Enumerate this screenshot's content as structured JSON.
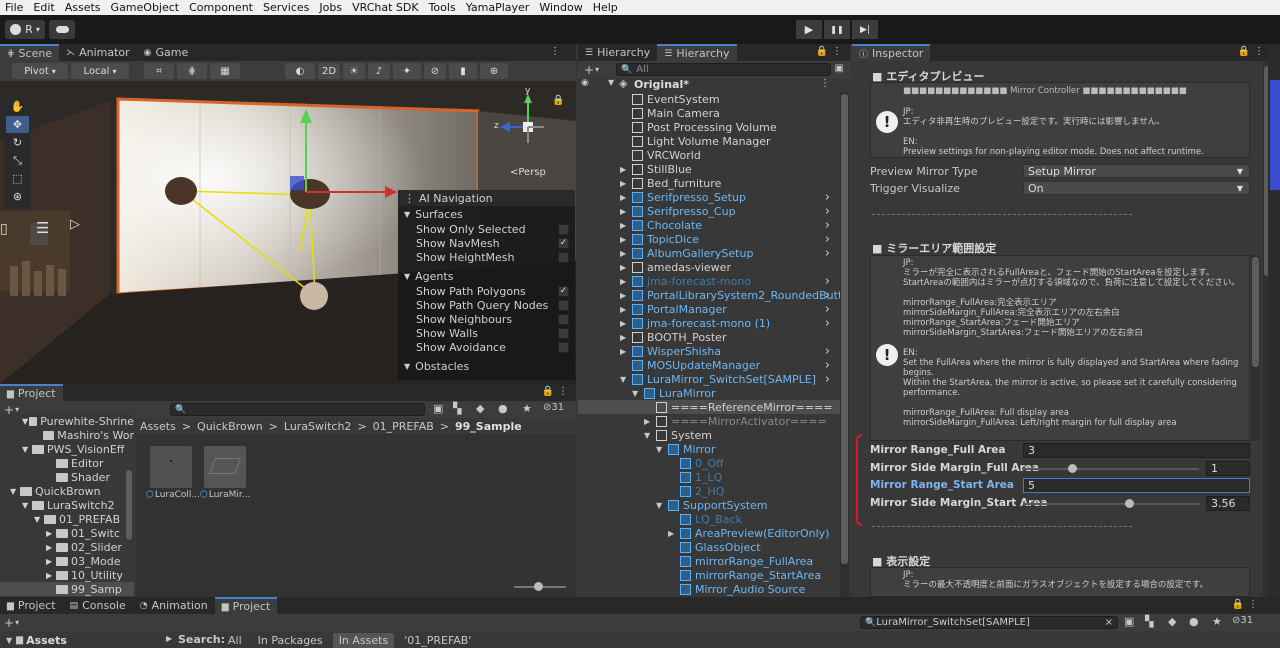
{
  "menubar": [
    "File",
    "Edit",
    "Assets",
    "GameObject",
    "Component",
    "Services",
    "Jobs",
    "VRChat SDK",
    "Tools",
    "YamaPlayer",
    "Window",
    "Help"
  ],
  "toolbar": {
    "account_label": "R",
    "cloud_icon": "cloud-icon",
    "play": "▶",
    "pause": "❚❚",
    "step": "▶|"
  },
  "scene": {
    "tabs": [
      "Scene",
      "Animator",
      "Game"
    ],
    "pivot": "Pivot",
    "local": "Local",
    "mode_2d": "2D",
    "persp": "<Persp",
    "gizmo_axes": {
      "y": "y",
      "z": "z"
    },
    "nav": {
      "title": "AI Navigation",
      "surfaces": "Surfaces",
      "surface_items": [
        {
          "label": "Show Only Selected",
          "checked": ""
        },
        {
          "label": "Show NavMesh",
          "checked": "✓"
        },
        {
          "label": "Show HeightMesh",
          "checked": ""
        }
      ],
      "agents": "Agents",
      "agent_items": [
        {
          "label": "Show Path Polygons",
          "checked": "✓"
        },
        {
          "label": "Show Path Query Nodes",
          "checked": ""
        },
        {
          "label": "Show Neighbours",
          "checked": ""
        },
        {
          "label": "Show Walls",
          "checked": ""
        },
        {
          "label": "Show Avoidance",
          "checked": ""
        }
      ],
      "obstacles": "Obstacles"
    }
  },
  "project": {
    "tab": "Project",
    "count": "31",
    "tree": [
      {
        "label": "Purewhite-Shrine",
        "indent": 2,
        "arrow": "▼"
      },
      {
        "label": "Mashiro's Wor",
        "indent": 3,
        "arrow": ""
      },
      {
        "label": "PWS_VisionEff",
        "indent": 2,
        "arrow": "▼"
      },
      {
        "label": "Editor",
        "indent": 4,
        "arrow": ""
      },
      {
        "label": "Shader",
        "indent": 4,
        "arrow": ""
      },
      {
        "label": "QuickBrown",
        "indent": 1,
        "arrow": "▼"
      },
      {
        "label": "LuraSwitch2",
        "indent": 2,
        "arrow": "▼"
      },
      {
        "label": "01_PREFAB",
        "indent": 3,
        "arrow": "▼"
      },
      {
        "label": "01_Switc",
        "indent": 4,
        "arrow": "▶"
      },
      {
        "label": "02_Slider",
        "indent": 4,
        "arrow": "▶"
      },
      {
        "label": "03_Mode",
        "indent": 4,
        "arrow": "▶"
      },
      {
        "label": "10_Utility",
        "indent": 4,
        "arrow": "▶"
      },
      {
        "label": "99_Samp",
        "indent": 4,
        "arrow": ""
      }
    ],
    "breadcrumb": [
      "Assets",
      "QuickBrown",
      "LuraSwitch2",
      "01_PREFAB",
      "99_Sample"
    ],
    "assets": [
      "LuraColl...",
      "LuraMir..."
    ]
  },
  "hierarchy": {
    "tabs": [
      "Hierarchy",
      "Hierarchy"
    ],
    "search_placeholder": "All",
    "scene": "Original*",
    "items": [
      {
        "label": "EventSystem",
        "indent": 1,
        "blue": false,
        "arrow": "",
        "more": false,
        "dim": false
      },
      {
        "label": "Main Camera",
        "indent": 1,
        "blue": false,
        "arrow": "",
        "more": false,
        "dim": false
      },
      {
        "label": "Post Processing Volume",
        "indent": 1,
        "blue": false,
        "arrow": "",
        "more": false,
        "dim": false
      },
      {
        "label": "Light Volume Manager",
        "indent": 1,
        "blue": false,
        "arrow": "",
        "more": false,
        "dim": false
      },
      {
        "label": "VRCWorld",
        "indent": 1,
        "blue": false,
        "arrow": "",
        "more": false,
        "dim": false
      },
      {
        "label": "StillBlue",
        "indent": 1,
        "blue": false,
        "arrow": "▶",
        "more": false,
        "dim": false
      },
      {
        "label": "Bed_furniture",
        "indent": 1,
        "blue": false,
        "arrow": "▶",
        "more": false,
        "dim": false
      },
      {
        "label": "Serifpresso_Setup",
        "indent": 1,
        "blue": true,
        "arrow": "▶",
        "more": true,
        "dim": false
      },
      {
        "label": "Serifpresso_Cup",
        "indent": 1,
        "blue": true,
        "arrow": "▶",
        "more": true,
        "dim": false
      },
      {
        "label": "Chocolate",
        "indent": 1,
        "blue": true,
        "arrow": "▶",
        "more": true,
        "dim": false
      },
      {
        "label": "TopicDice",
        "indent": 1,
        "blue": true,
        "arrow": "▶",
        "more": true,
        "dim": false
      },
      {
        "label": "AlbumGallerySetup",
        "indent": 1,
        "blue": true,
        "arrow": "▶",
        "more": true,
        "dim": false
      },
      {
        "label": "amedas-viewer",
        "indent": 1,
        "blue": false,
        "arrow": "▶",
        "more": false,
        "dim": false
      },
      {
        "label": "jma-forecast-mono",
        "indent": 1,
        "blue": true,
        "arrow": "▶",
        "more": true,
        "dim": true
      },
      {
        "label": "PortalLibrarySystem2_RoundedButto",
        "indent": 1,
        "blue": true,
        "arrow": "▶",
        "more": true,
        "dim": false
      },
      {
        "label": "PortalManager",
        "indent": 1,
        "blue": true,
        "arrow": "▶",
        "more": true,
        "dim": false
      },
      {
        "label": "jma-forecast-mono (1)",
        "indent": 1,
        "blue": true,
        "arrow": "▶",
        "more": true,
        "dim": false
      },
      {
        "label": "BOOTH_Poster",
        "indent": 1,
        "blue": false,
        "arrow": "▶",
        "more": false,
        "dim": false
      },
      {
        "label": "WisperShisha",
        "indent": 1,
        "blue": true,
        "arrow": "▶",
        "more": true,
        "dim": false
      },
      {
        "label": "MOSUpdateManager",
        "indent": 1,
        "blue": true,
        "arrow": "",
        "more": true,
        "dim": false
      },
      {
        "label": "LuraMirror_SwitchSet[SAMPLE]",
        "indent": 1,
        "blue": true,
        "arrow": "▼",
        "more": true,
        "dim": false
      },
      {
        "label": "LuraMirror",
        "indent": 2,
        "blue": true,
        "arrow": "▼",
        "more": false,
        "dim": false
      },
      {
        "label": "====ReferenceMirror====",
        "indent": 3,
        "blue": false,
        "arrow": "",
        "more": false,
        "dim": false,
        "selected": true
      },
      {
        "label": "====MirrorActivator====",
        "indent": 3,
        "blue": false,
        "arrow": "▶",
        "more": false,
        "dim": true
      },
      {
        "label": "System",
        "indent": 3,
        "blue": false,
        "arrow": "▼",
        "more": false,
        "dim": false
      },
      {
        "label": "Mirror",
        "indent": 4,
        "blue": true,
        "arrow": "▼",
        "more": false,
        "dim": false
      },
      {
        "label": "0_Off",
        "indent": 5,
        "blue": true,
        "arrow": "",
        "more": false,
        "dim": true
      },
      {
        "label": "1_LQ",
        "indent": 5,
        "blue": true,
        "arrow": "",
        "more": false,
        "dim": true
      },
      {
        "label": "2_HQ",
        "indent": 5,
        "blue": true,
        "arrow": "",
        "more": false,
        "dim": true
      },
      {
        "label": "SupportSystem",
        "indent": 4,
        "blue": true,
        "arrow": "▼",
        "more": false,
        "dim": false
      },
      {
        "label": "LQ_Back",
        "indent": 5,
        "blue": true,
        "arrow": "",
        "more": false,
        "dim": true
      },
      {
        "label": "AreaPreview(EditorOnly)",
        "indent": 5,
        "blue": true,
        "arrow": "▶",
        "more": false,
        "dim": false
      },
      {
        "label": "GlassObject",
        "indent": 5,
        "blue": true,
        "arrow": "",
        "more": false,
        "dim": false
      },
      {
        "label": "mirrorRange_FullArea",
        "indent": 5,
        "blue": true,
        "arrow": "",
        "more": false,
        "dim": false
      },
      {
        "label": "mirrorRange_StartArea",
        "indent": 5,
        "blue": true,
        "arrow": "",
        "more": false,
        "dim": false
      },
      {
        "label": "Mirror_Audio Source",
        "indent": 5,
        "blue": true,
        "arrow": "",
        "more": false,
        "dim": false
      }
    ]
  },
  "inspector": {
    "tab": "Inspector",
    "sec1": "■ エディタプレビュー",
    "mc_header": "■■■■■■■■■■■■■ Mirror Controller ■■■■■■■■■■■■■",
    "help1": {
      "jp_label": "JP:",
      "jp": "エディタ非再生時のプレビュー設定です。実行時には影響しません。",
      "en_label": "EN:",
      "en": "Preview settings for non-playing editor mode. Does not affect runtime."
    },
    "preview_type_label": "Preview Mirror Type",
    "preview_type_value": "Setup Mirror",
    "trigger_label": "Trigger Visualize",
    "trigger_value": "On",
    "sec2": "■ ミラーエリア範囲設定",
    "help2": {
      "jp_label": "JP:",
      "jp_lines": [
        "ミラーが完全に表示されるFullAreaと、フェード開始のStartAreaを設定します。",
        "StartAreaの範囲内はミラーが点灯する領域なので、負荷に注意して設定してください。"
      ],
      "jp_list": [
        "mirrorRange_FullArea:完全表示エリア",
        "mirrorSideMargin_FullArea:完全表示エリアの左右余白",
        "mirrorRange_StartArea:フェード開始エリア",
        "mirrorSideMargin_StartArea:フェード開始エリアの左右余白"
      ],
      "en_label": "EN:",
      "en_lines": [
        "Set the FullArea where the mirror is fully displayed and StartArea where fading",
        "begins.",
        "Within the StartArea, the mirror is active, so please set it carefully considering",
        "performance."
      ],
      "en_list": [
        "mirrorRange_FullArea: Full display area",
        "mirrorSideMargin_FullArea: Left/right margin for full display area"
      ]
    },
    "props": [
      {
        "label": "Mirror Range_Full Area",
        "value": "3",
        "slider": false,
        "highlight": false
      },
      {
        "label": "Mirror Side Margin_Full Area",
        "value": "1",
        "slider": true,
        "pos": 0.28,
        "highlight": false
      },
      {
        "label": "Mirror Range_Start Area",
        "value": "5",
        "slider": false,
        "highlight": true
      },
      {
        "label": "Mirror Side Margin_Start Area",
        "value": "3.56",
        "slider": true,
        "pos": 0.6,
        "highlight": false
      }
    ],
    "sec3": "■ 表示設定",
    "help3": {
      "jp_label": "JP:",
      "jp": "ミラーの最大不透明度と前面にガラスオブジェクトを設定する場合の設定です。"
    }
  },
  "bottom": {
    "tabs": [
      "Project",
      "Console",
      "Animation",
      "Project"
    ],
    "assets_label": "Assets",
    "search_label": "Search:",
    "filters": [
      "All",
      "In Packages",
      "In Assets",
      "'01_PREFAB'"
    ],
    "search_value": "LuraMirror_SwitchSet[SAMPLE]",
    "count": "31"
  }
}
